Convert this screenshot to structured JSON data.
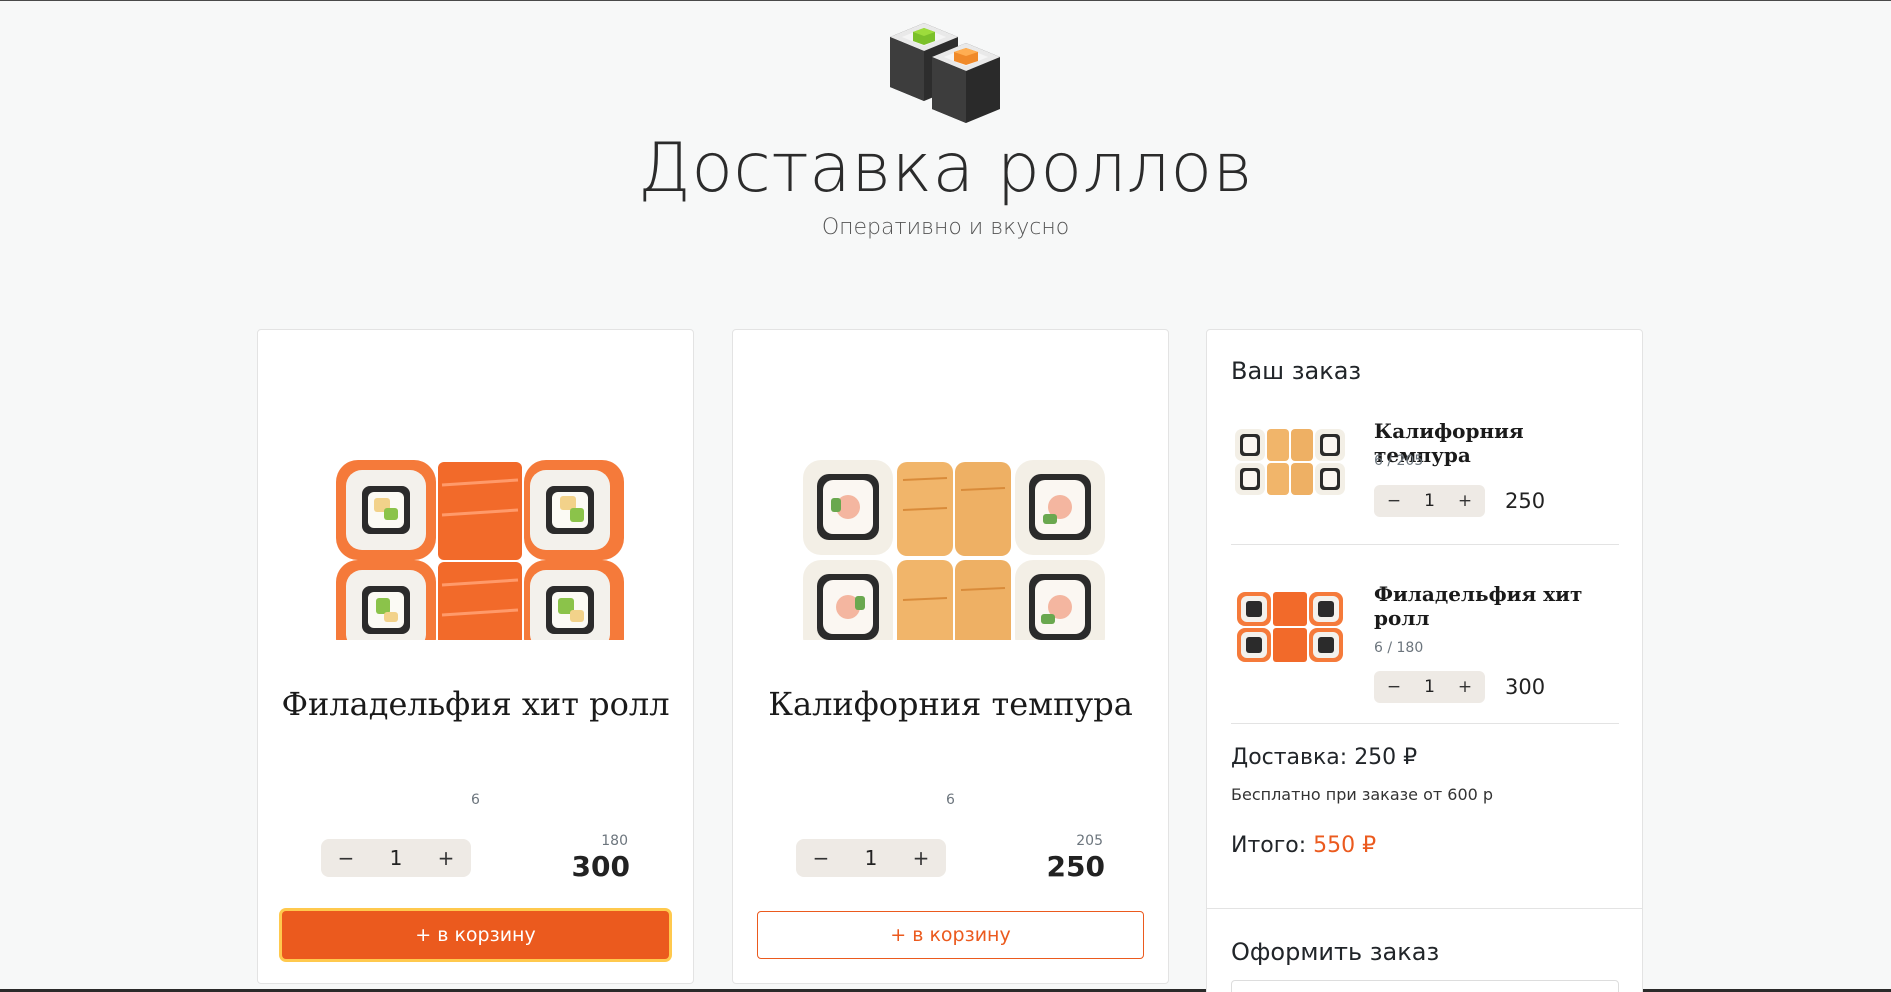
{
  "header": {
    "title": "Доставка роллов",
    "subtitle": "Оперативно и вкусно"
  },
  "products": [
    {
      "title": "Филадельфия хит ролл",
      "count": "6",
      "quantity": "1",
      "weight": "180",
      "price": "300",
      "add_label": "+ в корзину",
      "minus_label": "−",
      "plus_label": "+"
    },
    {
      "title": "Калифорния темпура",
      "count": "6",
      "quantity": "1",
      "weight": "205",
      "price": "250",
      "add_label": "+ в корзину",
      "minus_label": "−",
      "plus_label": "+"
    }
  ],
  "cart": {
    "title": "Ваш заказ",
    "items": [
      {
        "name": "Калифорния темпура",
        "meta": "6 / 205",
        "quantity": "1",
        "price": "250",
        "minus_label": "−",
        "plus_label": "+"
      },
      {
        "name": "Филадельфия хит ролл",
        "meta": "6 / 180",
        "quantity": "1",
        "price": "300",
        "minus_label": "−",
        "plus_label": "+"
      }
    ],
    "delivery_label": "Доставка:",
    "delivery_value": "250 ₽",
    "delivery_note": "Бесплатно при заказе от 600 р",
    "total_label": "Итого:",
    "total_value": "550 ₽"
  },
  "checkout": {
    "title": "Оформить заказ"
  },
  "colors": {
    "accent": "#eb5a1e",
    "focus_ring": "#ffc94d",
    "background": "#f7f8f8"
  }
}
